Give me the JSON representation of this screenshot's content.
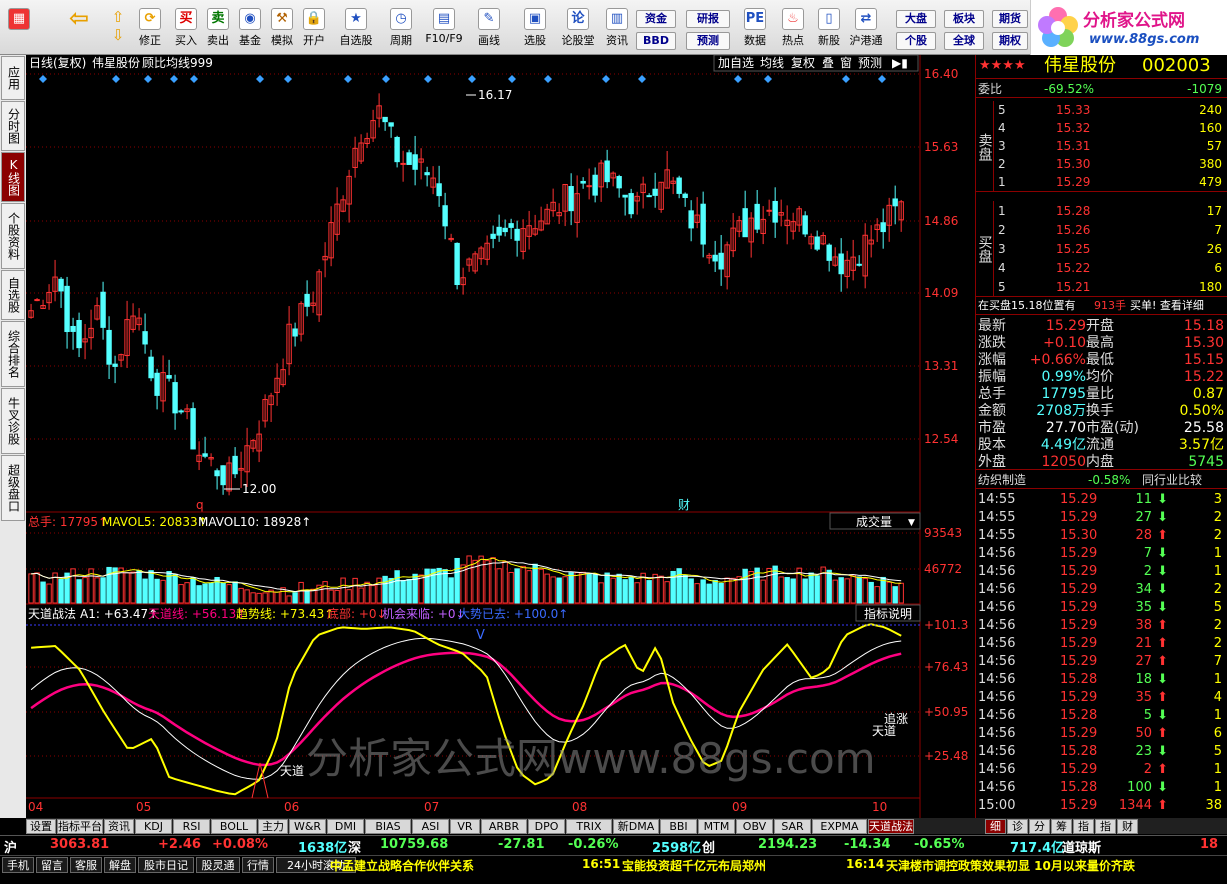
{
  "toolbar": {
    "buttons": [
      "修正",
      "买入",
      "卖出",
      "基金",
      "模拟",
      "开户",
      "自选股",
      "周期",
      "F10/F9",
      "画线",
      "选股",
      "论股堂",
      "资讯",
      "数据",
      "热点",
      "新股",
      "沪港通"
    ],
    "small": [
      "资金",
      "BBD",
      "研报",
      "预测",
      "大盘",
      "个股",
      "板块",
      "全球",
      "期货",
      "期权"
    ]
  },
  "logo": {
    "title": "分析家公式网",
    "url": "www.88gs.com"
  },
  "leftnav": [
    "应用",
    "分时图",
    "K线图",
    "个股资料",
    "自选股",
    "综合排名",
    "牛叉诊股",
    "超级盘口"
  ],
  "chart": {
    "period_label": "日线(复权)",
    "stock_name": "伟星股份",
    "indicator_name": "顾比均线999",
    "top_buttons": [
      "加自选",
      "均线",
      "复权",
      "叠",
      "窗",
      "预测"
    ],
    "price_labels": [
      "16.40",
      "15.63",
      "14.86",
      "14.09",
      "13.31",
      "12.54"
    ],
    "high_label": "16.17",
    "low_label": "12.00",
    "marker_q": "q",
    "marker_cai": "财",
    "volume_header": {
      "total": "总手: 17795↑",
      "mavol5": "MAVOL5: 20833↑",
      "mavol10": "MAVOL10: 18928↑"
    },
    "volume_select": "成交量",
    "volume_labels": [
      "93543",
      "46772"
    ],
    "indicator_header": {
      "name": "天道战法",
      "a1": "A1: +63.47↑",
      "tiandao": "天道线: +56.13↑",
      "trend": "趋势线: +73.43↑",
      "bottom": "底部: +0↓",
      "chance": "机会来临: +0↓",
      "bigtrend": "大势已去: +100.0↑"
    },
    "indicator_help": "指标说明",
    "indicator_labels": [
      "+101.3",
      "+76.43",
      "+50.95",
      "+25.48"
    ],
    "indicator_marks": [
      "天道",
      "追涨",
      "天道",
      "V"
    ],
    "months": [
      "04",
      "05",
      "06",
      "07",
      "08",
      "09",
      "10"
    ],
    "watermark": "分析家公式网www.88gs.com"
  },
  "quote": {
    "stars": "★★★★",
    "name": "伟星股份",
    "code": "002003",
    "weibi": {
      "label": "委比",
      "pct": "-69.52%",
      "diff": "-1079"
    },
    "sell": [
      {
        "lv": "5",
        "p": "15.33",
        "v": "240"
      },
      {
        "lv": "4",
        "p": "15.32",
        "v": "160"
      },
      {
        "lv": "3",
        "p": "15.31",
        "v": "57"
      },
      {
        "lv": "2",
        "p": "15.30",
        "v": "380"
      },
      {
        "lv": "1",
        "p": "15.29",
        "v": "479"
      }
    ],
    "buy": [
      {
        "lv": "1",
        "p": "15.28",
        "v": "17"
      },
      {
        "lv": "2",
        "p": "15.26",
        "v": "7"
      },
      {
        "lv": "3",
        "p": "15.25",
        "v": "26"
      },
      {
        "lv": "4",
        "p": "15.22",
        "v": "6"
      },
      {
        "lv": "5",
        "p": "15.21",
        "v": "180"
      }
    ],
    "sell_label": "卖盘",
    "buy_label": "买盘",
    "note": {
      "left": "在买盘15.18位置有",
      "vol": "913手",
      "right": "买单! 查看详细"
    },
    "stats": [
      [
        "最新",
        "15.29",
        "开盘",
        "15.18"
      ],
      [
        "涨跌",
        "+0.10",
        "最高",
        "15.30"
      ],
      [
        "涨幅",
        "+0.66%",
        "最低",
        "15.15"
      ],
      [
        "振幅",
        "0.99%",
        "均价",
        "15.22"
      ],
      [
        "总手",
        "17795",
        "量比",
        "0.87"
      ],
      [
        "金额",
        "2708万",
        "换手",
        "0.50%"
      ],
      [
        "市盈",
        "27.70",
        "市盈(动)",
        "25.58"
      ],
      [
        "股本",
        "4.49亿",
        "流通",
        "3.57亿"
      ],
      [
        "外盘",
        "12050",
        "内盘",
        "5745"
      ]
    ],
    "industry": {
      "name": "纺织制造",
      "pct": "-0.58%",
      "compare": "同行业比较"
    },
    "ticks": [
      [
        "14:55",
        "15.29",
        "11",
        "3",
        "g"
      ],
      [
        "14:55",
        "15.29",
        "27",
        "2",
        "g"
      ],
      [
        "14:55",
        "15.30",
        "28",
        "2",
        "r"
      ],
      [
        "14:56",
        "15.29",
        "7",
        "1",
        "g"
      ],
      [
        "14:56",
        "15.29",
        "2",
        "1",
        "g"
      ],
      [
        "14:56",
        "15.29",
        "34",
        "2",
        "g"
      ],
      [
        "14:56",
        "15.29",
        "35",
        "5",
        "g"
      ],
      [
        "14:56",
        "15.29",
        "38",
        "2",
        "r"
      ],
      [
        "14:56",
        "15.29",
        "21",
        "2",
        "r"
      ],
      [
        "14:56",
        "15.29",
        "27",
        "7",
        "r"
      ],
      [
        "14:56",
        "15.28",
        "18",
        "1",
        "g"
      ],
      [
        "14:56",
        "15.29",
        "35",
        "4",
        "r"
      ],
      [
        "14:56",
        "15.28",
        "5",
        "1",
        "g"
      ],
      [
        "14:56",
        "15.29",
        "50",
        "6",
        "r"
      ],
      [
        "14:56",
        "15.28",
        "23",
        "5",
        "g"
      ],
      [
        "14:56",
        "15.29",
        "2",
        "1",
        "r"
      ],
      [
        "14:56",
        "15.28",
        "100",
        "1",
        "g"
      ],
      [
        "15:00",
        "15.29",
        "1344",
        "38",
        "r"
      ]
    ],
    "bottom_btns": [
      "细",
      "诊",
      "分",
      "筹",
      "指",
      "指",
      "财"
    ]
  },
  "tabs": [
    "设置",
    "指标平台",
    "资讯",
    "KDJ",
    "RSI",
    "BOLL",
    "主力",
    "W&R",
    "DMI",
    "BIAS",
    "ASI",
    "VR",
    "ARBR",
    "DPO",
    "TRIX",
    "新DMA",
    "BBI",
    "MTM",
    "OBV",
    "SAR",
    "EXPMA",
    "天道战法"
  ],
  "indexbar": {
    "hu": "沪",
    "hu_val": "3063.81",
    "hu_chg": "+2.46",
    "hu_pct": "+0.08%",
    "hu_amt": "1638亿",
    "shen": "深",
    "shen_val": "10759.68",
    "shen_chg": "-27.81",
    "shen_pct": "-0.26%",
    "shen_amt": "2598亿",
    "chuang": "创",
    "chuang_val": "2194.23",
    "chuang_chg": "-14.34",
    "chuang_pct": "-0.65%",
    "dj_amt": "717.4亿",
    "dj": "道琼斯",
    "last": "18"
  },
  "newsbar": {
    "buttons": [
      "手机",
      "留言",
      "客服",
      "解盘",
      "股市日记",
      "股灵通",
      "行情",
      "24小时滚动"
    ],
    "news1": "中孟建立战略合作伙伴关系",
    "time2": "16:51",
    "news2": "宝能投资超千亿元布局郑州",
    "time3": "16:14",
    "news3": "天津楼市调控政策效果初显 10月以来量价齐跌"
  },
  "colors": {
    "up": "#ff3232",
    "down": "#54ffff",
    "yellow": "#ffff00",
    "pink": "#ff0080"
  }
}
